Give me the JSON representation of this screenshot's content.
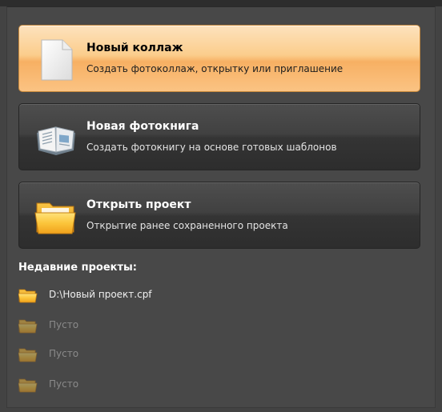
{
  "actions": [
    {
      "title": "Новый коллаж",
      "description": "Создать фотоколлаж, открытку или приглашение",
      "icon": "blank-document-icon",
      "state": "highlighted"
    },
    {
      "title": "Новая фотокнига",
      "description": "Создать фотокнигу на основе готовых шаблонов",
      "icon": "open-book-icon",
      "state": "normal"
    },
    {
      "title": "Открыть проект",
      "description": "Открытие ранее сохраненного проекта",
      "icon": "folder-icon",
      "state": "normal"
    }
  ],
  "recent": {
    "heading": "Недавние проекты:",
    "items": [
      {
        "label": "D:\\Новый проект.cpf",
        "icon": "folder-icon"
      },
      {
        "label": "Пусто",
        "icon": "folder-icon"
      },
      {
        "label": "Пусто",
        "icon": "folder-icon"
      },
      {
        "label": "Пусто",
        "icon": "folder-icon"
      }
    ]
  },
  "colors": {
    "highlight_top": "#fde2bd",
    "highlight_mid": "#f7b063",
    "panel_bg": "#484848",
    "folder": "#f6b52a"
  }
}
